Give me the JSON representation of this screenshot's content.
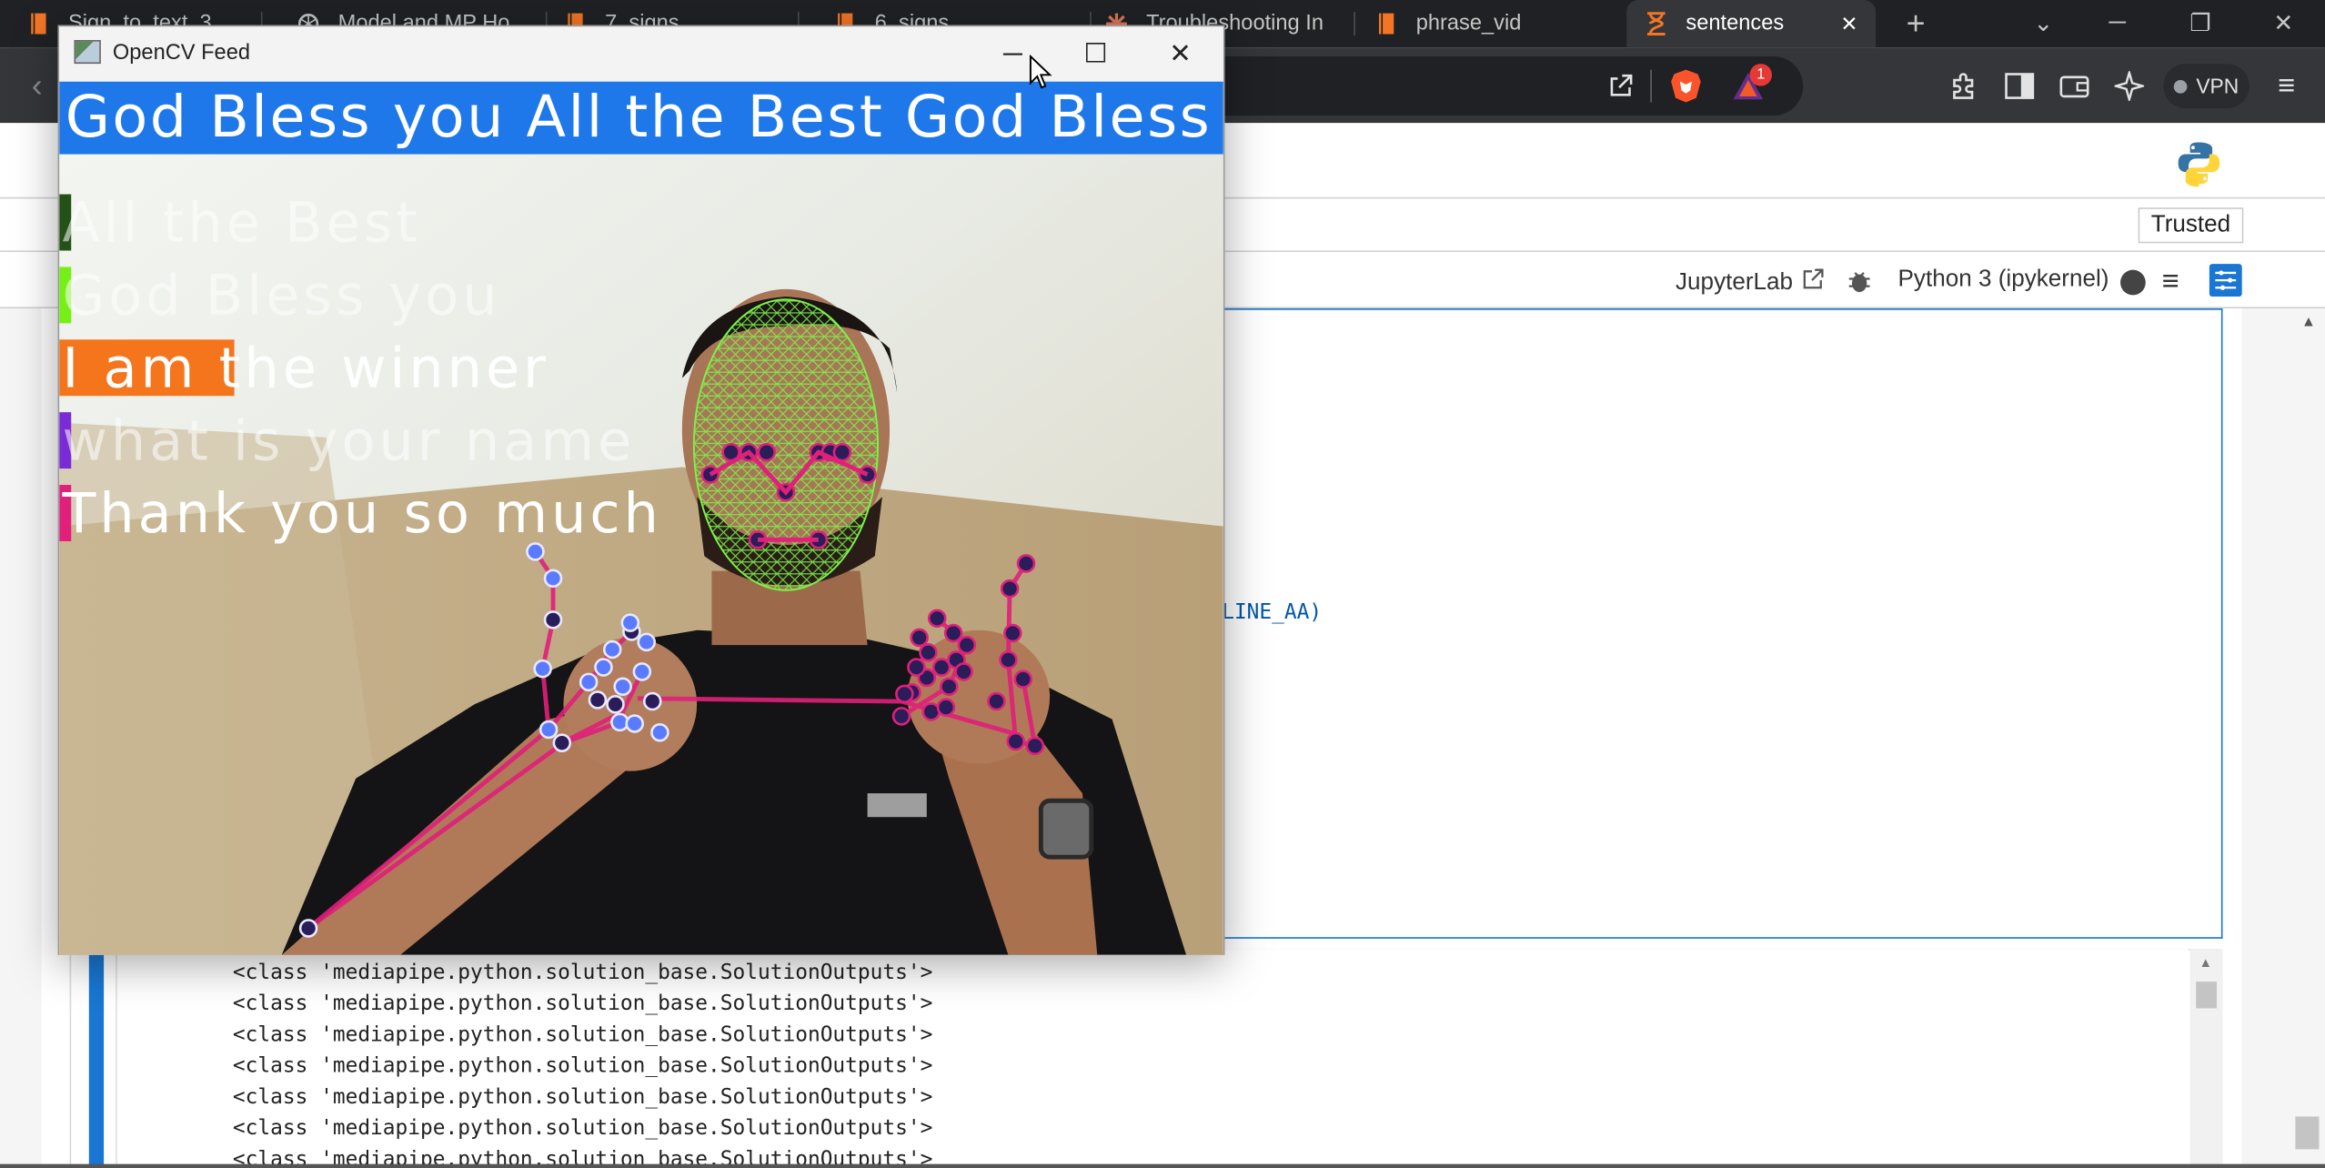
{
  "browser": {
    "tabs": [
      {
        "label": "Sign_to_text_3",
        "icon": "jupyter-book-icon"
      },
      {
        "label": "Model and MP Ho",
        "icon": "openai-icon"
      },
      {
        "label": "7_signs",
        "icon": "jupyter-book-icon"
      },
      {
        "label": "6_signs",
        "icon": "jupyter-book-icon"
      },
      {
        "label": "Troubleshooting In",
        "icon": "claude-icon"
      },
      {
        "label": "phrase_vid",
        "icon": "jupyter-book-icon"
      },
      {
        "label": "sentences",
        "icon": "hourglass-icon",
        "active": true
      }
    ],
    "new_tab": "+",
    "tab_search": "⌄",
    "vpn_label": "VPN",
    "brave_rewards_badge": "1"
  },
  "jupyter": {
    "trusted_label": "Trusted",
    "jupyterlab_label": "JupyterLab",
    "kernel_label": "Python 3 (ipykernel)",
    "code_fragment": "LINE_AA)",
    "output_lines": [
      "<class 'mediapipe.python.solution_base.SolutionOutputs'>",
      "<class 'mediapipe.python.solution_base.SolutionOutputs'>",
      "<class 'mediapipe.python.solution_base.SolutionOutputs'>",
      "<class 'mediapipe.python.solution_base.SolutionOutputs'>",
      "<class 'mediapipe.python.solution_base.SolutionOutputs'>",
      "<class 'mediapipe.python.solution_base.SolutionOutputs'>",
      "<class 'mediapipe.python.solution_base.SolutionOutputs'>"
    ]
  },
  "opencv": {
    "window_title": "OpenCV Feed",
    "banner_text": "God Bless you All the Best God Bless yo",
    "banner_color": "#1e78ea",
    "options": [
      {
        "label": "All the Best",
        "probability": 0.01,
        "color": "#245117"
      },
      {
        "label": "God Bless you",
        "probability": 0.01,
        "color": "#75f016"
      },
      {
        "label": "I am the winner",
        "probability": 0.15,
        "color": "#f5751d"
      },
      {
        "label": "what is your name",
        "probability": 0.01,
        "color": "#7a2bd8"
      },
      {
        "label": "Thank you so much",
        "probability": 0.01,
        "color": "#e0207a"
      }
    ],
    "face_mesh_color": "#7cf24a",
    "hand_connection_color": "#e0207a"
  }
}
